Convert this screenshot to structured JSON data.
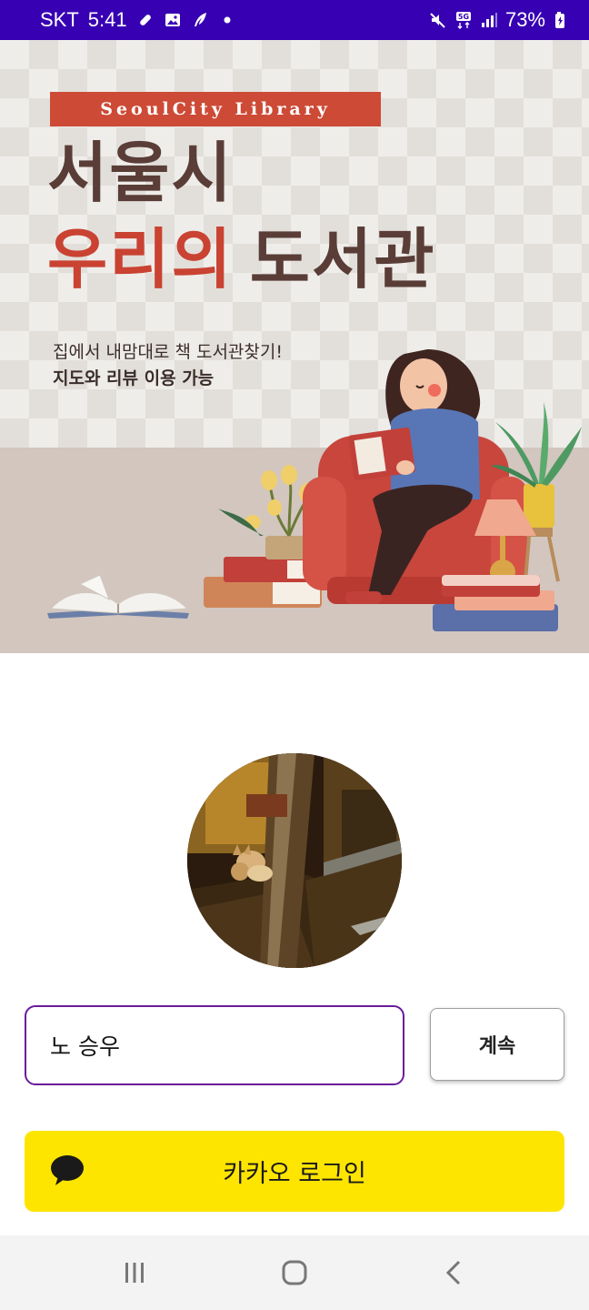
{
  "status_bar": {
    "carrier": "SKT",
    "time": "5:41",
    "battery": "73%",
    "left_icons": [
      "pill-icon",
      "image-icon",
      "quill-icon",
      "dot-icon"
    ],
    "right_icons": [
      "mute-icon",
      "5g-icon",
      "signal-icon",
      "battery-icon"
    ]
  },
  "banner": {
    "tag": "SeoulCity Library",
    "line1": "서울시",
    "line2_accent": "우리의",
    "line2_rest": "도서관",
    "sub1": "집에서 내맘대로 책 도서관찾기!",
    "sub2": "지도와  리뷰 이용 가능"
  },
  "form": {
    "name_value": "노 승우",
    "continue_label": "계속"
  },
  "kakao": {
    "label": "카카오 로그인"
  },
  "nav": {
    "icons": [
      "recent-apps-icon",
      "home-icon",
      "back-icon"
    ]
  },
  "colors": {
    "status_bar": "#3700b3",
    "banner_accent": "#cd4a36",
    "input_border": "#6a1b9a",
    "kakao_yellow": "#fee500"
  }
}
